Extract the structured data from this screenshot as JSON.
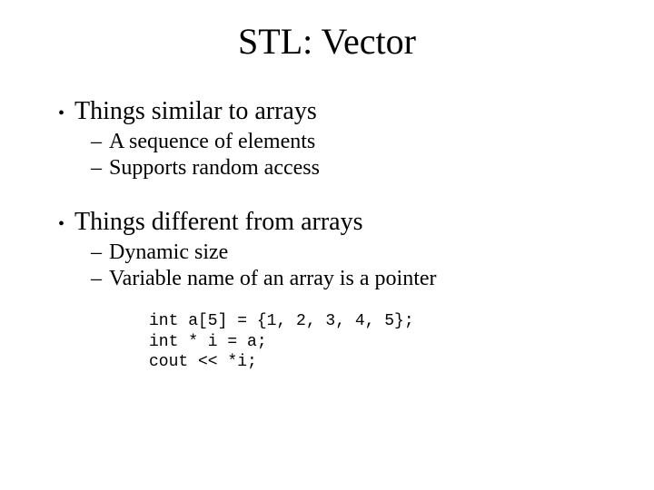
{
  "title": "STL: Vector",
  "sections": [
    {
      "heading": "Things similar to arrays",
      "items": [
        "A sequence of elements",
        "Supports random access"
      ]
    },
    {
      "heading": "Things different from arrays",
      "items": [
        "Dynamic size",
        "Variable name of an array is a pointer"
      ]
    }
  ],
  "code": "int a[5] = {1, 2, 3, 4, 5};\nint * i = a;\ncout << *i;"
}
